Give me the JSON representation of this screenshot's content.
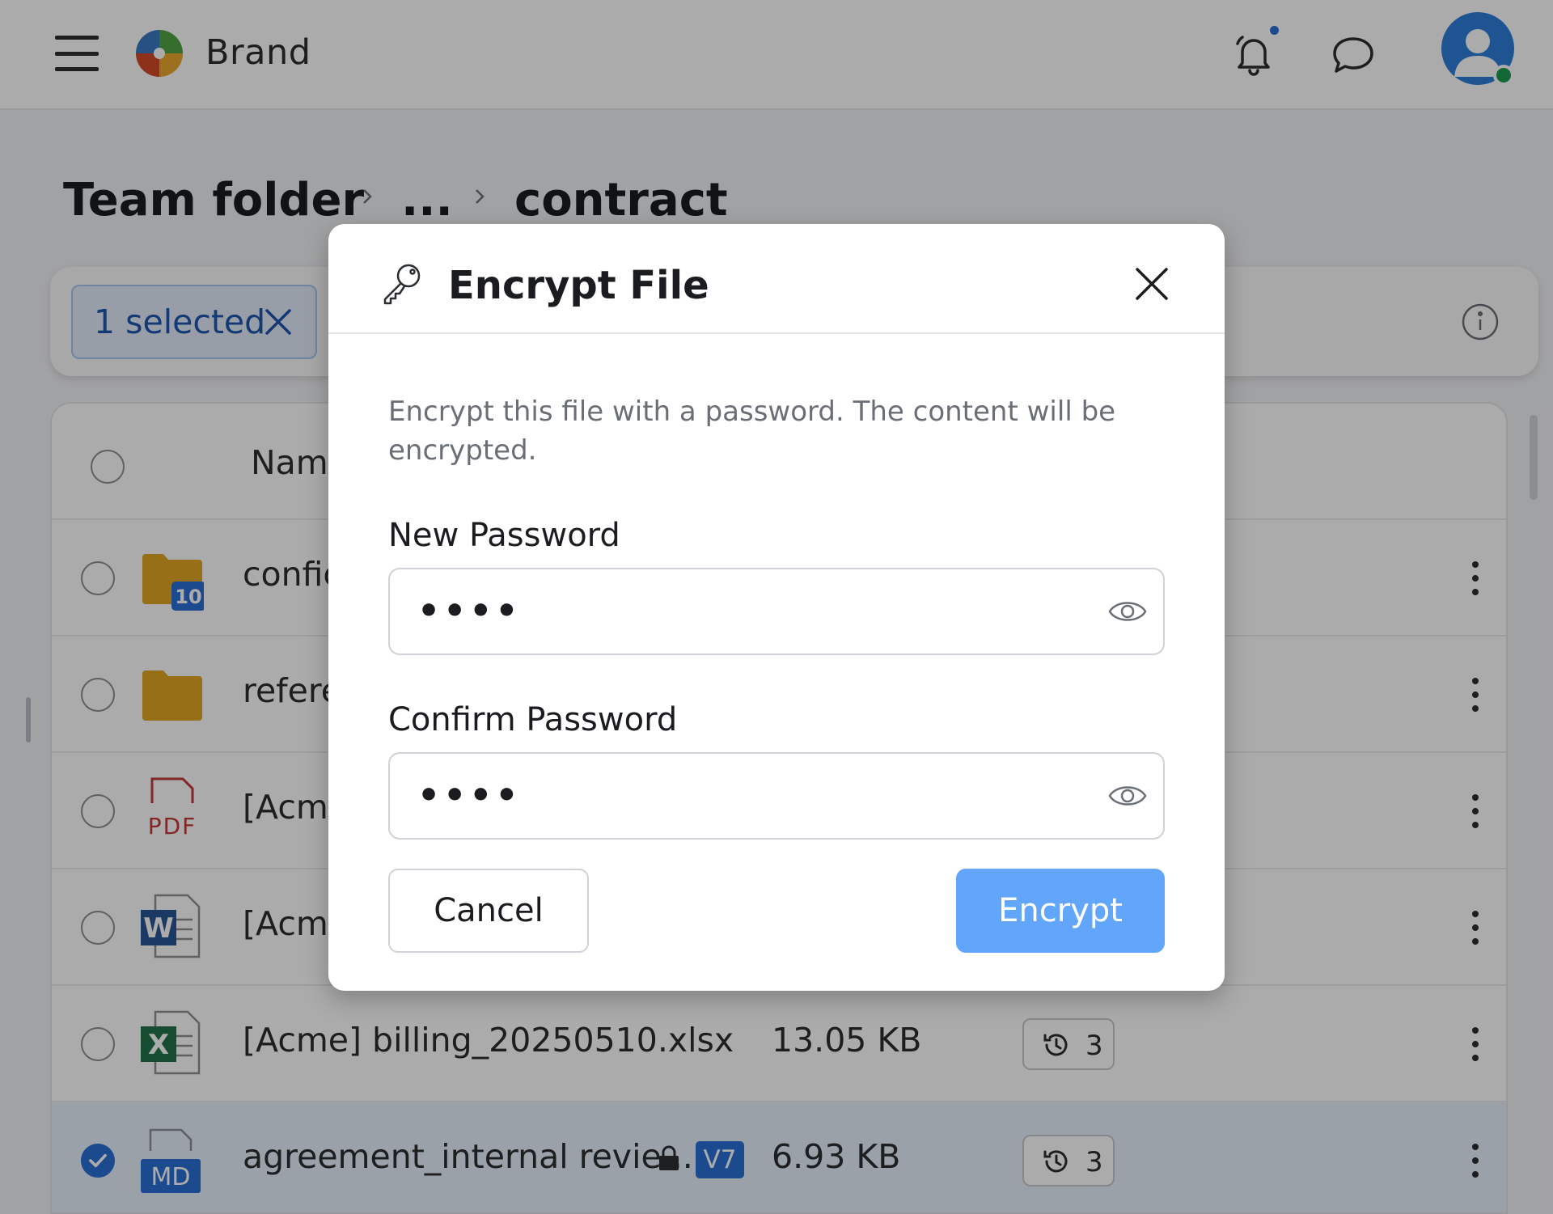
{
  "header": {
    "brand": "Brand",
    "icons": [
      "menu-icon",
      "logo-icon",
      "bell-icon",
      "chat-icon",
      "avatar-icon"
    ],
    "notification_dot_color": "#2b6fd6",
    "presence_status_color": "#1a9c50"
  },
  "breadcrumb": {
    "root": "Team folder",
    "ellipsis": "...",
    "current": "contract"
  },
  "toolbar": {
    "selected_label": "1 selected"
  },
  "table": {
    "header": {
      "name": "Name"
    },
    "rows": [
      {
        "type": "folder",
        "name": "confic",
        "badge": "10",
        "size": "",
        "history": "",
        "selected": false
      },
      {
        "type": "folder",
        "name": "refere",
        "size": "",
        "history": "",
        "selected": false
      },
      {
        "type": "pdf",
        "type_label": "PDF",
        "name": "[Acme",
        "size": "",
        "history": "",
        "selected": false
      },
      {
        "type": "word",
        "type_label": "W",
        "name": "[Acme",
        "size": "",
        "history": "",
        "selected": false
      },
      {
        "type": "excel",
        "type_label": "X",
        "name": "[Acme] billing_20250510.xlsx",
        "size": "13.05 KB",
        "history": "3",
        "selected": false
      },
      {
        "type": "markdown",
        "type_label": "MD",
        "name": "agreement_internal revie...",
        "version": "V7",
        "locked": true,
        "size": "6.93 KB",
        "history": "3",
        "selected": true
      }
    ]
  },
  "modal": {
    "title": "Encrypt File",
    "description": "Encrypt this file with a password. The content will be encrypted.",
    "new_password_label": "New Password",
    "new_password_value": "••••",
    "confirm_password_label": "Confirm Password",
    "confirm_password_value": "••••",
    "cancel_label": "Cancel",
    "encrypt_label": "Encrypt",
    "accent_color": "#62a6fb"
  }
}
